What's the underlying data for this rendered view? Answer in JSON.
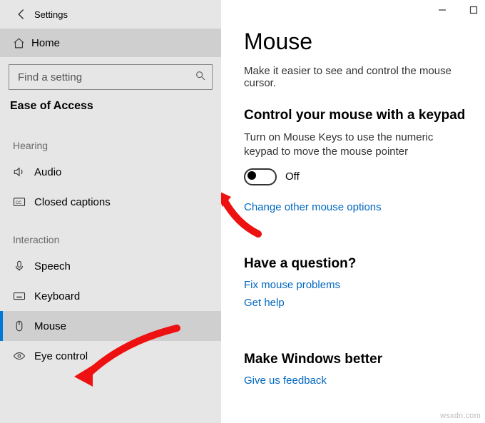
{
  "window": {
    "title": "Settings"
  },
  "home": {
    "label": "Home"
  },
  "search": {
    "placeholder": "Find a setting"
  },
  "section": {
    "title": "Ease of Access"
  },
  "groups": {
    "hearing": {
      "label": "Hearing"
    },
    "interaction": {
      "label": "Interaction"
    }
  },
  "nav": {
    "audio": "Audio",
    "closed_captions": "Closed captions",
    "speech": "Speech",
    "keyboard": "Keyboard",
    "mouse": "Mouse",
    "eye_control": "Eye control"
  },
  "page": {
    "title": "Mouse",
    "subtitle": "Make it easier to see and control the mouse cursor.",
    "control_heading": "Control your mouse with a keypad",
    "control_desc": "Turn on Mouse Keys to use the numeric keypad to move the mouse pointer",
    "toggle_state": "Off",
    "change_link": "Change other mouse options",
    "question_heading": "Have a question?",
    "fix_link": "Fix mouse problems",
    "help_link": "Get help",
    "better_heading": "Make Windows better",
    "feedback_link": "Give us feedback"
  },
  "watermark": "wsxdn.com"
}
